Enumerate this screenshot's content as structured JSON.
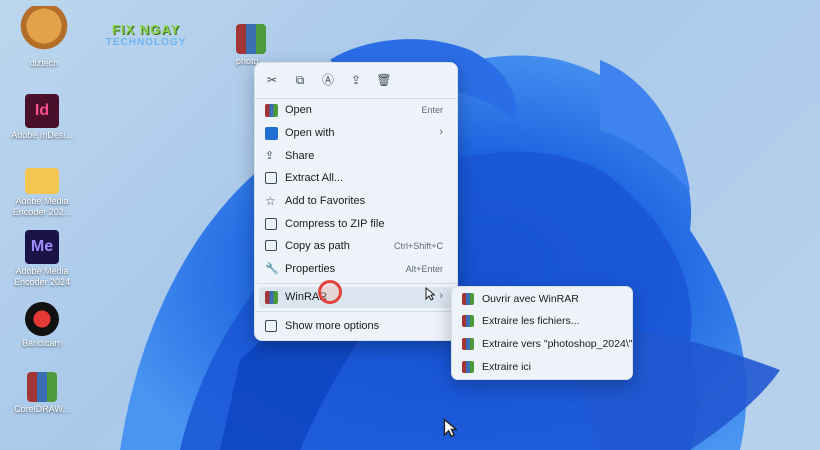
{
  "brand": {
    "line1": "FIX NGAY",
    "line2": "TECHNOLOGY"
  },
  "desktop_icons": [
    {
      "label": "dlztech",
      "icon": "beaver-mascot-icon"
    },
    {
      "label": "photo...",
      "icon": "winrar-archive-icon"
    },
    {
      "label": "Adobe InDesi...",
      "icon": "indesign-icon"
    },
    {
      "label": "Adobe Media Encoder 202...",
      "icon": "folder-icon"
    },
    {
      "label": "Adobe Media Encoder 2024",
      "icon": "media-encoder-icon"
    },
    {
      "label": "Bandicam",
      "icon": "bandicam-icon"
    },
    {
      "label": "CorelDRAW...",
      "icon": "winrar-archive-icon"
    }
  ],
  "context_menu": {
    "toolbar": [
      {
        "name": "cut",
        "icon": "scissors-icon"
      },
      {
        "name": "copy",
        "icon": "copy-icon"
      },
      {
        "name": "rename",
        "icon": "rename-icon"
      },
      {
        "name": "share",
        "icon": "share-icon"
      },
      {
        "name": "delete",
        "icon": "trash-icon"
      }
    ],
    "items": [
      {
        "label": "Open",
        "shortcut": "Enter",
        "icon": "winrar-icon"
      },
      {
        "label": "Open with",
        "shortcut": "",
        "icon": "open-with-icon"
      },
      {
        "label": "Share",
        "shortcut": "",
        "icon": "share-icon"
      },
      {
        "label": "Extract All...",
        "shortcut": "",
        "icon": "extract-icon"
      },
      {
        "label": "Add to Favorites",
        "shortcut": "",
        "icon": "star-icon"
      },
      {
        "label": "Compress to ZIP file",
        "shortcut": "",
        "icon": "zip-icon"
      },
      {
        "label": "Copy as path",
        "shortcut": "Ctrl+Shift+C",
        "icon": "path-icon"
      },
      {
        "label": "Properties",
        "shortcut": "Alt+Enter",
        "icon": "wrench-icon"
      },
      {
        "label": "WinRAR",
        "shortcut": "",
        "icon": "winrar-icon"
      },
      {
        "label": "Show more options",
        "shortcut": "",
        "icon": "more-options-icon"
      }
    ]
  },
  "winrar_submenu": {
    "items": [
      {
        "label": "Ouvrir avec WinRAR"
      },
      {
        "label": "Extraire les fichiers..."
      },
      {
        "label": "Extraire vers \"photoshop_2024\\\""
      },
      {
        "label": "Extraire ici"
      }
    ]
  },
  "colors": {
    "accent": "#1f6fd1",
    "menu_bg": "#eef3fa",
    "highlight": "#dbe5f0",
    "cursor_ring": "#e0433a"
  }
}
